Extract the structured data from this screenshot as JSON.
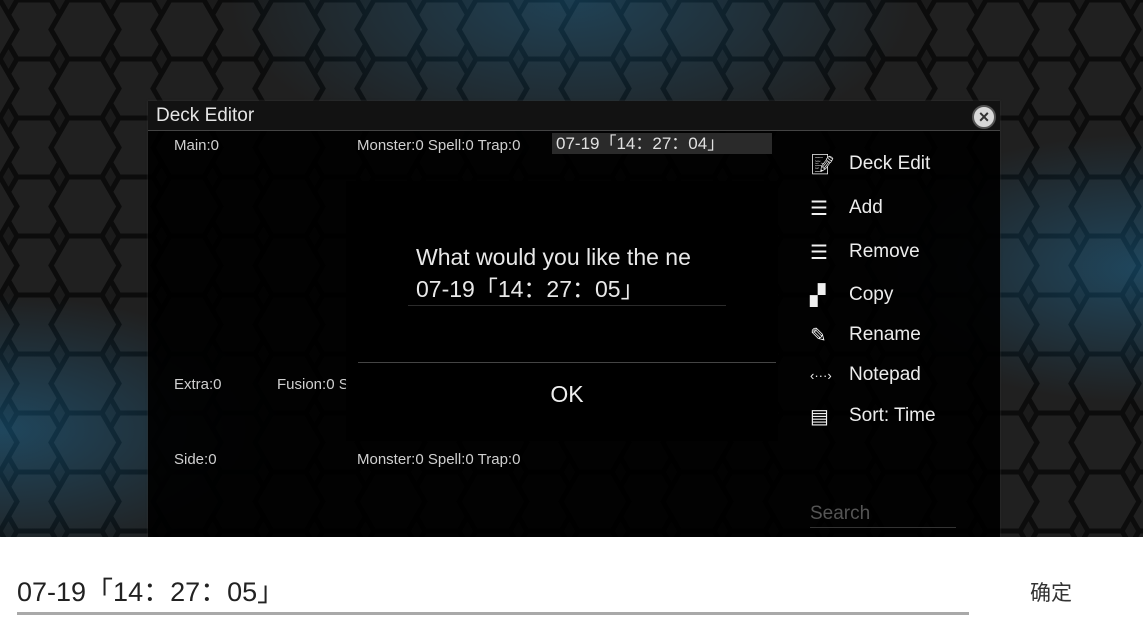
{
  "window": {
    "title": "Deck Editor",
    "close_icon": "close-circle-icon"
  },
  "deck": {
    "name": "07-19「14：27：04」",
    "main_label": "Main:0",
    "main_counts": "Monster:0 Spell:0 Trap:0",
    "extra_label": "Extra:0",
    "extra_counts": "Fusion:0 S",
    "side_label": "Side:0",
    "side_counts": "Monster:0 Spell:0 Trap:0"
  },
  "menu": [
    {
      "label": "Deck Edit",
      "icon": "edit-document-icon"
    },
    {
      "label": "Add",
      "icon": "list-add-icon"
    },
    {
      "label": "Remove",
      "icon": "list-remove-icon"
    },
    {
      "label": "Copy",
      "icon": "copy-icon"
    },
    {
      "label": "Rename",
      "icon": "pencil-icon"
    },
    {
      "label": "Notepad",
      "icon": "code-dots-icon"
    },
    {
      "label": "Sort: Time",
      "icon": "document-icon"
    }
  ],
  "search": {
    "placeholder": "Search"
  },
  "dialog": {
    "prompt": "What would you like the ne",
    "value": "07-19「14：27：05」",
    "ok_label": "OK"
  },
  "ime": {
    "value": "07-19「14：27：05」",
    "confirm_label": "确定"
  },
  "colors": {
    "accent_glow": "#1e8fd0",
    "panel": "#000000"
  }
}
